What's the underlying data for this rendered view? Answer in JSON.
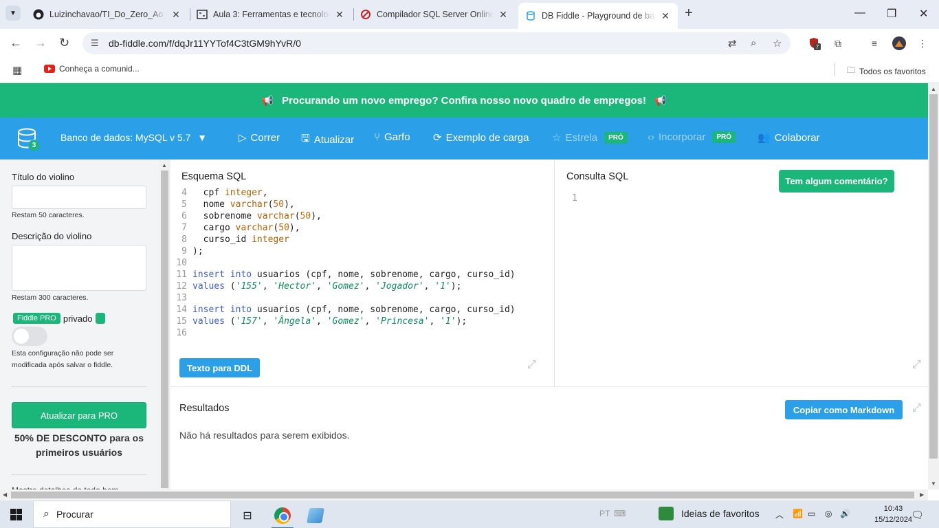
{
  "browser": {
    "tabs": [
      {
        "title": "Luizinchavao/TI_Do_Zero_Ao_P...",
        "icon": "github-icon"
      },
      {
        "title": "Aula 3: Ferramentas e tecnologi...",
        "icon": "course-icon"
      },
      {
        "title": "Compilador SQL Server Online ...",
        "icon": "compiler-icon"
      },
      {
        "title": "DB Fiddle - Playground de banc...",
        "icon": "dbfiddle-icon",
        "active": true
      }
    ],
    "url": "db-fiddle.com/f/dqJr11YYTof4C3tGM9hYvR/0",
    "extension_badge": "7",
    "bookmark": "Conheça a comunid...",
    "all_bookmarks": "Todos os favoritos"
  },
  "banner": {
    "text": "Procurando um novo emprego? Confira nosso novo quadro de empregos!"
  },
  "toolbar": {
    "db_count": "3",
    "database": "Banco de dados: MySQL v 5.7",
    "run": "Correr",
    "update": "Atualizar",
    "fork": "Garfo",
    "load_example": "Exemplo de carga",
    "star": "Estrela",
    "embed": "Incorporar",
    "pro": "PRÓ",
    "collaborate": "Colaborar"
  },
  "sidebar": {
    "title_label": "Título do violino",
    "title_remaining": "Restam 50 caracteres.",
    "desc_label": "Descrição do violino",
    "desc_remaining": "Restam 300 caracteres.",
    "fiddle_pro": "Fiddle PRO",
    "private": "privado",
    "private_note": "Esta configuração não pode ser modificada após salvar o fiddle.",
    "upgrade": "Atualizar para PRO",
    "discount": "50% DE DESCONTO para os primeiros usuários",
    "cut_text": "Mostre detalhes do todo bem"
  },
  "schema": {
    "title": "Esquema SQL",
    "ddl_button": "Texto para DDL",
    "lines": [
      {
        "n": "4",
        "html": "  cpf <span class=\"ty\">integer</span>,"
      },
      {
        "n": "5",
        "html": "  nome <span class=\"ty\">varchar</span>(<span class=\"nm\">50</span>),"
      },
      {
        "n": "6",
        "html": "  sobrenome <span class=\"ty\">varchar</span>(<span class=\"nm\">50</span>),"
      },
      {
        "n": "7",
        "html": "  cargo <span class=\"ty\">varchar</span>(<span class=\"nm\">50</span>),"
      },
      {
        "n": "8",
        "html": "  curso_id <span class=\"ty\">integer</span>"
      },
      {
        "n": "9",
        "html": ");"
      },
      {
        "n": "10",
        "html": ""
      },
      {
        "n": "11",
        "html": "<span class=\"kw\">insert into</span> usuarios (cpf, nome, sobrenome, cargo, curso_id)"
      },
      {
        "n": "12",
        "html": "<span class=\"kw\">values</span> (<span class=\"st\">'155'</span>, <span class=\"st\">'Hector'</span>, <span class=\"st\">'Gomez'</span>, <span class=\"st\">'Jogador'</span>, <span class=\"st\">'1'</span>);"
      },
      {
        "n": "13",
        "html": ""
      },
      {
        "n": "14",
        "html": "<span class=\"kw\">insert into</span> usuarios (cpf, nome, sobrenome, cargo, curso_id)"
      },
      {
        "n": "15",
        "html": "<span class=\"kw\">values</span> (<span class=\"st\">'157'</span>, <span class=\"st\">'Ângela'</span>, <span class=\"st\">'Gomez'</span>, <span class=\"st\">'Princesa'</span>, <span class=\"st\">'1'</span>);"
      },
      {
        "n": "16",
        "html": ""
      }
    ]
  },
  "query": {
    "title": "Consulta SQL",
    "feedback": "Tem algum comentário?",
    "line1": "1"
  },
  "results": {
    "title": "Resultados",
    "copy_md": "Copiar como Markdown",
    "empty": "Não há resultados para serem exibidos."
  },
  "taskbar": {
    "search": "Procurar",
    "lang": "PT",
    "news": "Ideias de favoritos",
    "time": "10:43",
    "date": "15/12/2024"
  },
  "colors": {
    "green": "#1bb67a",
    "blue": "#2b9fe8"
  }
}
